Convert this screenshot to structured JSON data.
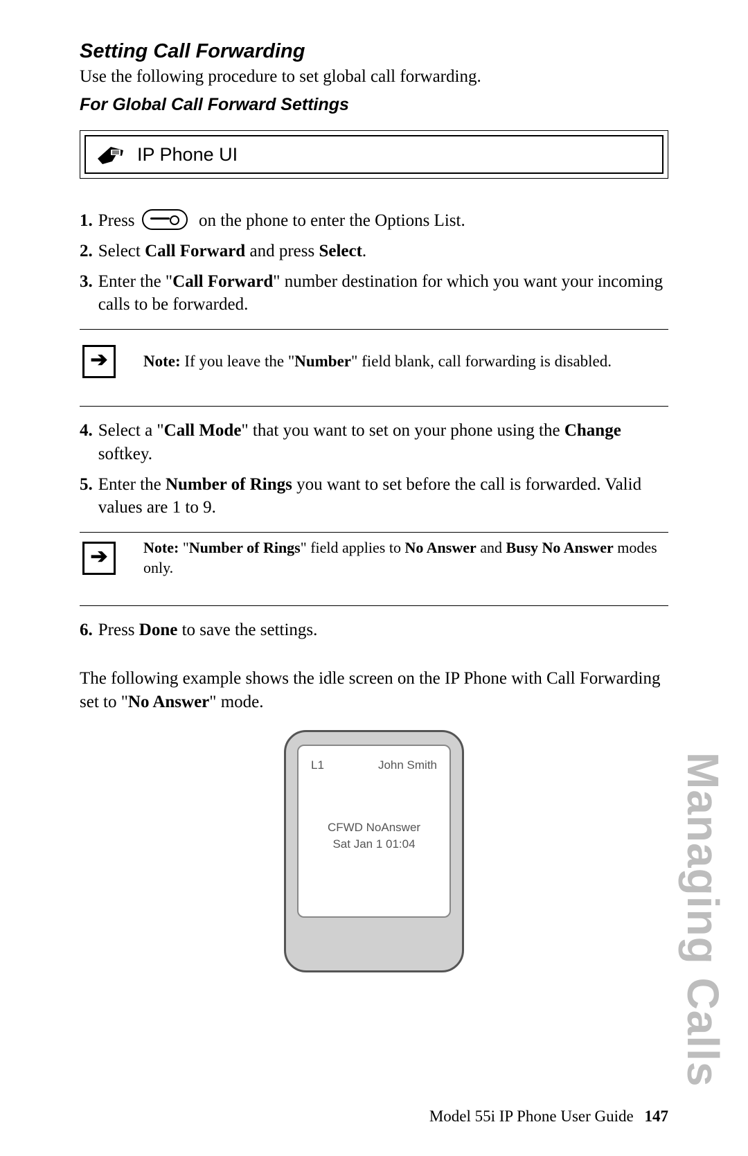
{
  "title": "Setting Call Forwarding",
  "intro": "Use the following procedure to set global call forwarding.",
  "subtitle": "For Global Call Forward Settings",
  "ip_box_label": "IP Phone UI",
  "steps": {
    "s1_a": "Press",
    "s1_b": "on the phone to enter the Options List.",
    "s2_a": "Select ",
    "s2_b": "Call Forward",
    "s2_c": " and press ",
    "s2_d": "Select",
    "s2_e": ".",
    "s3_a": "Enter the \"",
    "s3_b": "Call Forward",
    "s3_c": "\" number destination for which you want your incoming calls to be forwarded.",
    "s4_a": "Select a \"",
    "s4_b": "Call Mode",
    "s4_c": "\" that you want to set on your phone using the ",
    "s4_d": "Change",
    "s4_e": " softkey.",
    "s5_a": "Enter the ",
    "s5_b": "Number of Rings",
    "s5_c": " you want to set before the call is forwarded. Valid values are 1 to 9.",
    "s6_a": "Press ",
    "s6_b": "Done",
    "s6_c": " to save the settings."
  },
  "note1": {
    "label": "Note:",
    "text_a": " If you leave the \"",
    "text_b": "Number",
    "text_c": "\" field blank, call forwarding is disabled."
  },
  "note2": {
    "label": "Note:",
    "text_a": " \"",
    "text_b": "Number of Rings",
    "text_c": "\" field applies to ",
    "text_d": "No Answer",
    "text_e": " and ",
    "text_f": "Busy No Answer",
    "text_g": " modes only."
  },
  "example_para_a": "The following example shows the idle screen on the IP Phone with Call Forwarding set to \"",
  "example_para_b": "No Answer",
  "example_para_c": "\" mode.",
  "phone_screen": {
    "line": "L1",
    "name": "John Smith",
    "cfwd": "CFWD NoAnswer",
    "date": "Sat Jan 1 01:04"
  },
  "side_text": "Managing Calls",
  "footer_text": "Model 55i IP Phone User Guide",
  "page_number": "147",
  "nums": {
    "n1": "1.",
    "n2": "2.",
    "n3": "3.",
    "n4": "4.",
    "n5": "5.",
    "n6": "6."
  }
}
